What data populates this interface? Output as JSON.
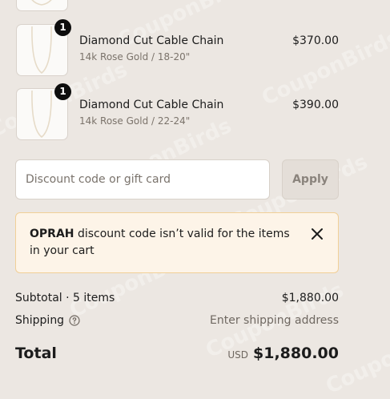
{
  "watermark": "CouponBirds",
  "cart": {
    "items": [
      {
        "qty": "1",
        "title": "Diamond Cut Cable Chain",
        "variant": "14k Rose Gold / 18-20\"",
        "price": "$370.00"
      },
      {
        "qty": "1",
        "title": "Diamond Cut Cable Chain",
        "variant": "14k Rose Gold / 22-24\"",
        "price": "$390.00"
      }
    ]
  },
  "discount": {
    "placeholder": "Discount code or gift card",
    "apply_label": "Apply"
  },
  "error_banner": {
    "code": "OPRAH",
    "message": " discount code isn’t valid for the items in your cart",
    "close_icon": "close-icon"
  },
  "summary": {
    "subtotal_label": "Subtotal · 5 items",
    "subtotal_value": "$1,880.00",
    "shipping_label": "Shipping",
    "shipping_value": "Enter shipping address",
    "help_icon": "question-circle-icon",
    "total_label": "Total",
    "currency": "USD",
    "total_value": "$1,880.00"
  },
  "colors": {
    "background": "#ece7e2",
    "banner_bg": "#fdf4e8",
    "banner_border": "#f1cf97",
    "qty_badge": "#0d0d0d"
  }
}
